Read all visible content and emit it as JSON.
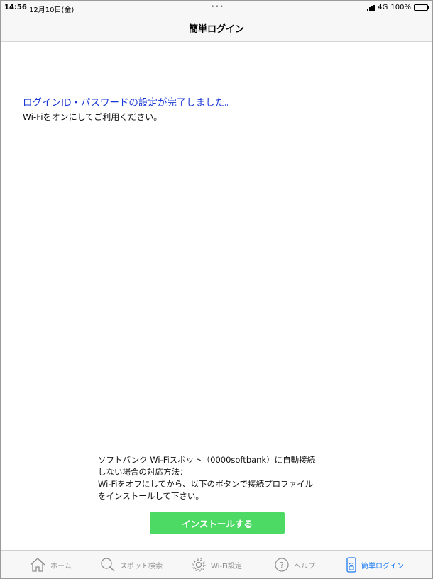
{
  "status_bar": {
    "time": "14:56",
    "date": "12月10日(金)",
    "dots": "•••",
    "network": "4G",
    "battery": "100%"
  },
  "nav": {
    "title": "簡単ログイン"
  },
  "message": {
    "title": "ログインID・パスワードの設定が完了しました。",
    "subtitle": "Wi-Fiをオンにしてご利用ください。"
  },
  "info_lines": [
    "ソフトバンク Wi-Fiスポット（0000softbank）に自動接続",
    "しない場合の対応方法：",
    "Wi-Fiをオフにしてから、以下のボタンで接続プロファイル",
    "をインストールして下さい。"
  ],
  "install_button": "インストールする",
  "tabs": [
    {
      "label": "ホーム",
      "icon": "home-icon"
    },
    {
      "label": "スポット検索",
      "icon": "search-icon"
    },
    {
      "label": "Wi-Fi設定",
      "icon": "gear-icon"
    },
    {
      "label": "ヘルプ",
      "icon": "question-icon"
    },
    {
      "label": "簡単ログイン",
      "icon": "phone-icon",
      "active": true
    }
  ],
  "colors": {
    "accent_blue": "#1d7cf2",
    "message_blue": "#1a38d6",
    "button_green": "#4cd964"
  }
}
